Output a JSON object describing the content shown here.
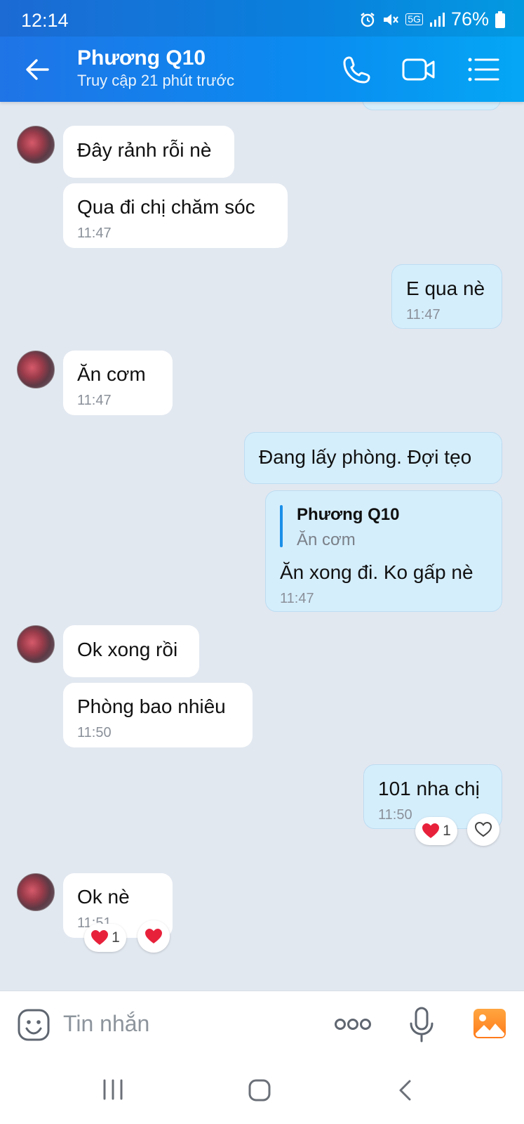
{
  "status_bar": {
    "time": "12:14",
    "network": "5G",
    "battery": "76%"
  },
  "header": {
    "contact_name": "Phương Q10",
    "last_seen": "Truy cập 21 phút trước"
  },
  "messages": [
    {
      "id": "m1",
      "side": "in",
      "text": "Đây rảnh rỗi nè",
      "time": ""
    },
    {
      "id": "m2",
      "side": "in",
      "text": "Qua đi chị chăm sóc",
      "time": "11:47"
    },
    {
      "id": "m3",
      "side": "out",
      "text": "E qua nè",
      "time": "11:47"
    },
    {
      "id": "m4",
      "side": "in",
      "text": "Ăn cơm",
      "time": "11:47"
    },
    {
      "id": "m5",
      "side": "out",
      "text": "Đang lấy phòng. Đợi tẹo",
      "time": ""
    },
    {
      "id": "m6",
      "side": "out",
      "text": "Ăn xong đi. Ko gấp nè",
      "time": "11:47",
      "reply_to": {
        "name": "Phương Q10",
        "text": "Ăn cơm"
      }
    },
    {
      "id": "m7",
      "side": "in",
      "text": "Ok xong rồi",
      "time": ""
    },
    {
      "id": "m8",
      "side": "in",
      "text": "Phòng bao nhiêu",
      "time": "11:50"
    },
    {
      "id": "m9",
      "side": "out",
      "text": "101 nha chị",
      "time": "11:50",
      "reaction_count": "1"
    },
    {
      "id": "m10",
      "side": "in",
      "text": "Ok nè",
      "time": "11:51",
      "reaction_count": "1"
    }
  ],
  "input": {
    "placeholder": "Tin nhắn"
  },
  "colors": {
    "header_start": "#1f74e6",
    "header_end": "#04a7f5",
    "outgoing_bubble": "#d5eefc",
    "background": "#e2e8f0",
    "heart": "#e8213b"
  },
  "icons": [
    "back-arrow-icon",
    "phone-icon",
    "video-call-icon",
    "menu-list-icon",
    "sticker-icon",
    "more-icon",
    "microphone-icon",
    "image-icon",
    "heart-icon"
  ]
}
